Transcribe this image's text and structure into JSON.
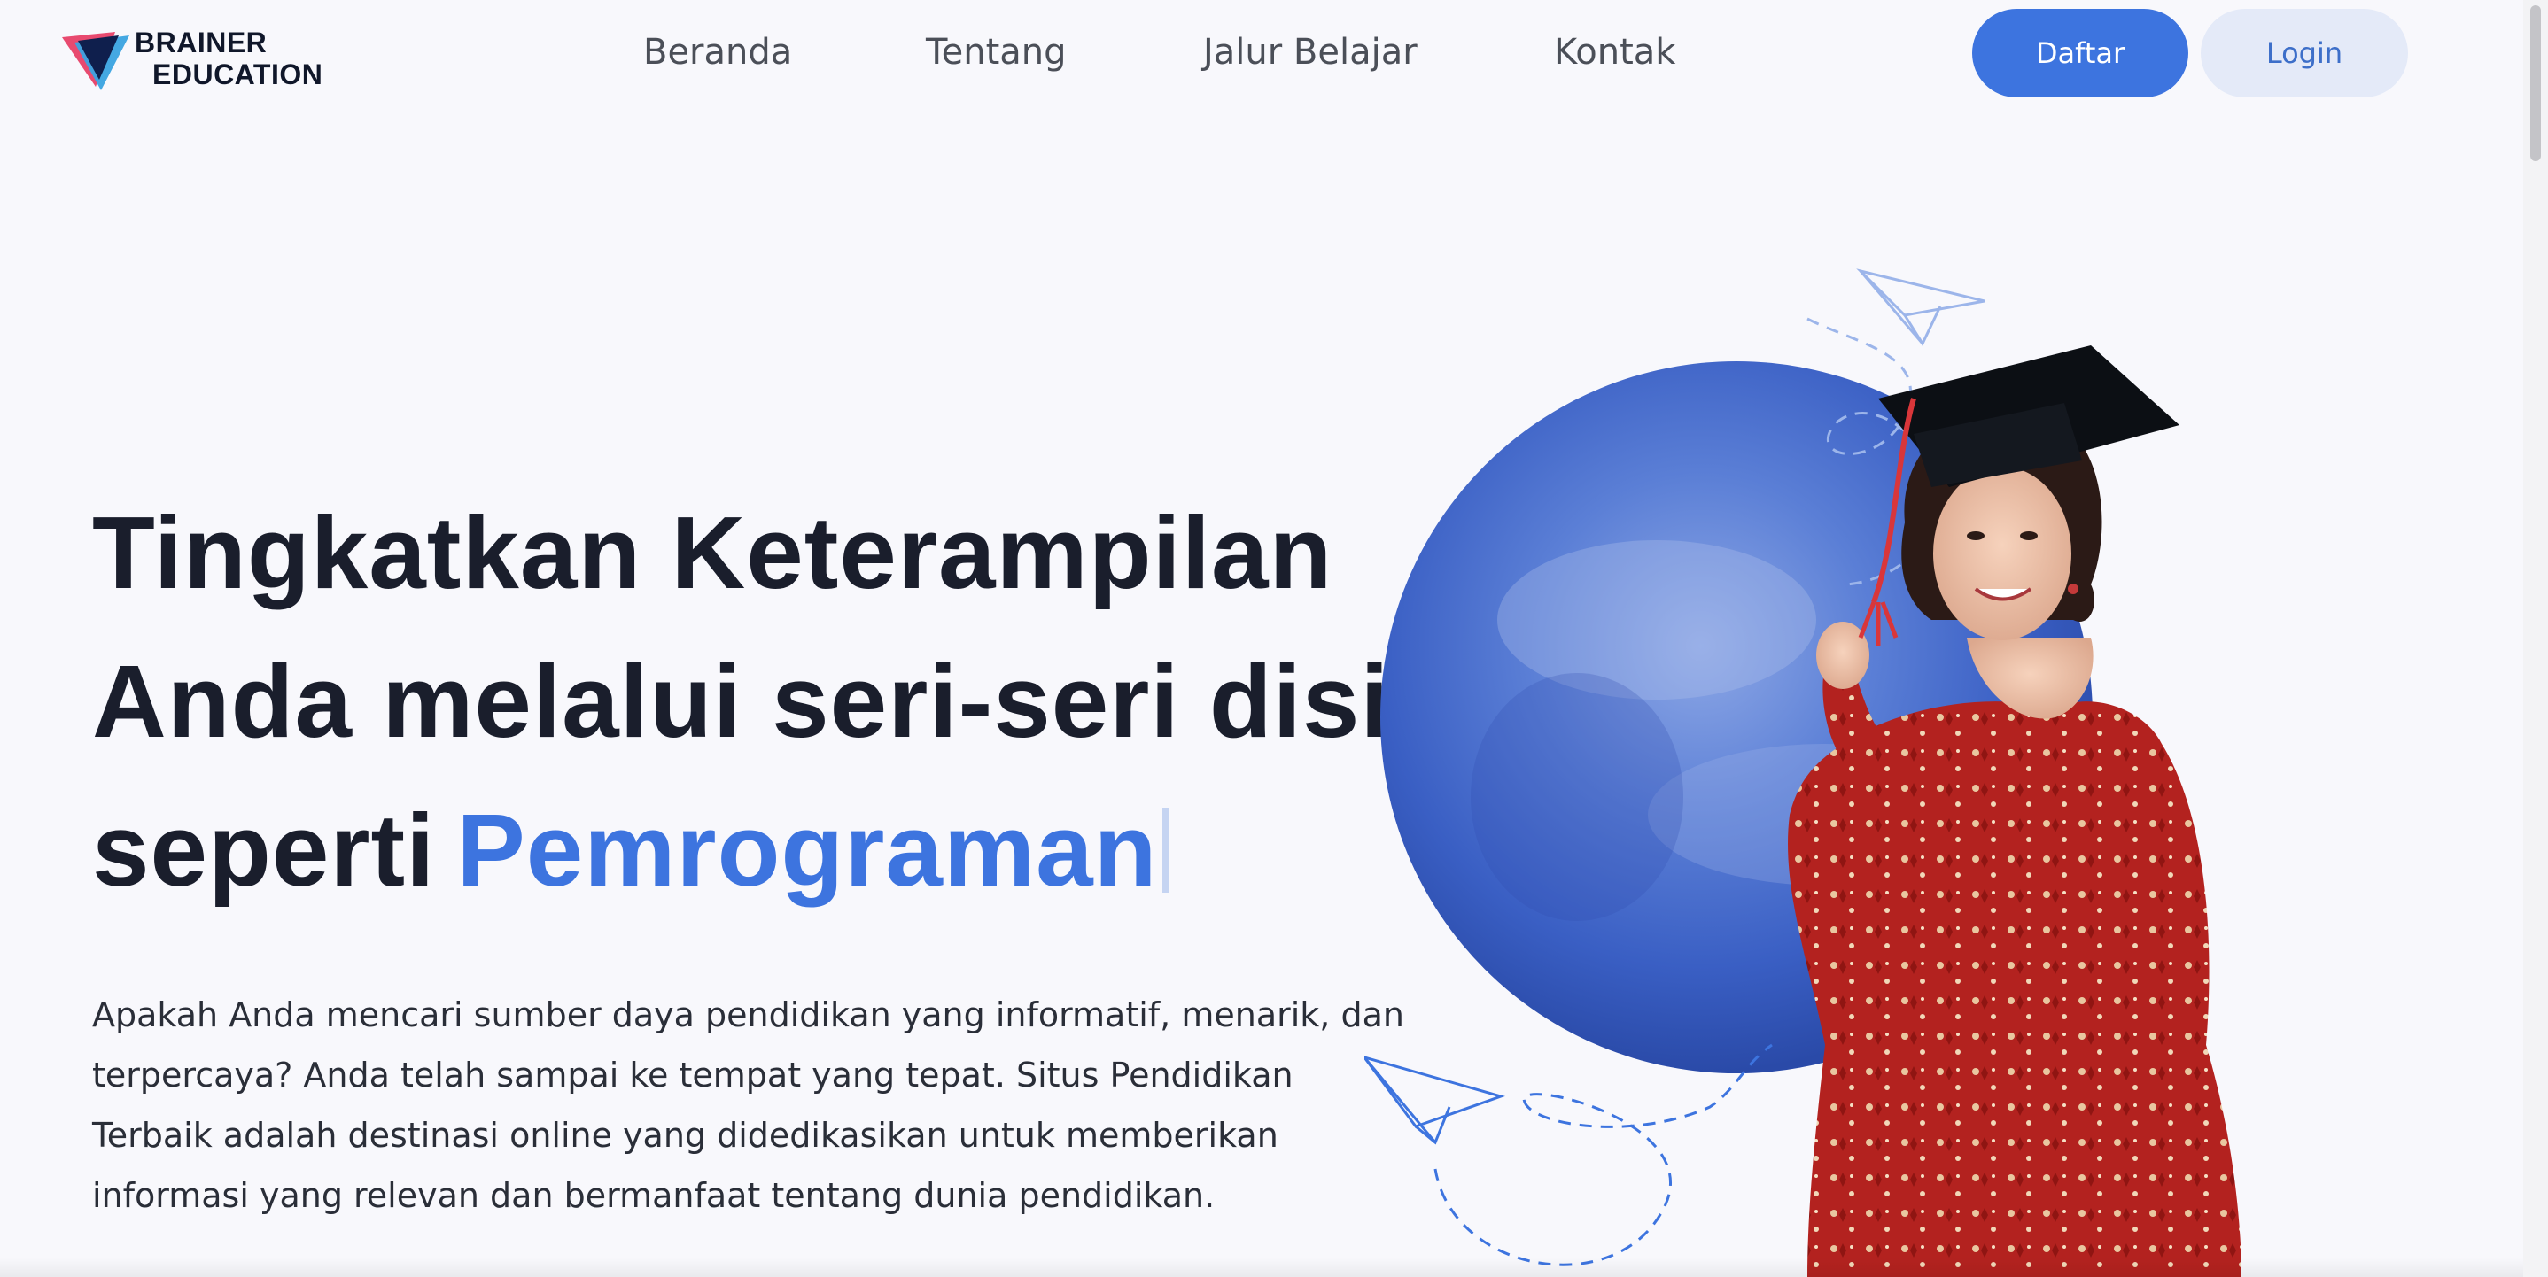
{
  "header": {
    "logo_line1": "BRAINER",
    "logo_line2": "EDUCATION",
    "nav": [
      {
        "label": "Beranda"
      },
      {
        "label": "Tentang"
      },
      {
        "label": "Jalur Belajar"
      },
      {
        "label": "Kontak"
      }
    ],
    "register_label": "Daftar",
    "login_label": "Login"
  },
  "hero": {
    "title_line1": "Tingkatkan Keterampilan",
    "title_line2": "Anda melalui seri-seri disini",
    "title_line3_prefix": "seperti",
    "typed_word": "Pemrograman",
    "description": "Apakah Anda mencari sumber daya pendidikan yang informatif, menarik, dan terpercaya? Anda telah sampai ke tempat yang tepat. Situs Pendidikan Terbaik adalah destinasi online yang didedikasikan untuk memberikan informasi yang relevan dan bermanfaat tentang dunia pendidikan."
  },
  "colors": {
    "accent": "#3d74df",
    "login_bg": "#e4eaf8",
    "title_text": "#1a1e2c",
    "dress_red": "#b3221f",
    "circle_blue": "#3f66c9"
  },
  "icons": {
    "logo": "triangle-logo-icon",
    "plane": "paper-plane-icon"
  }
}
